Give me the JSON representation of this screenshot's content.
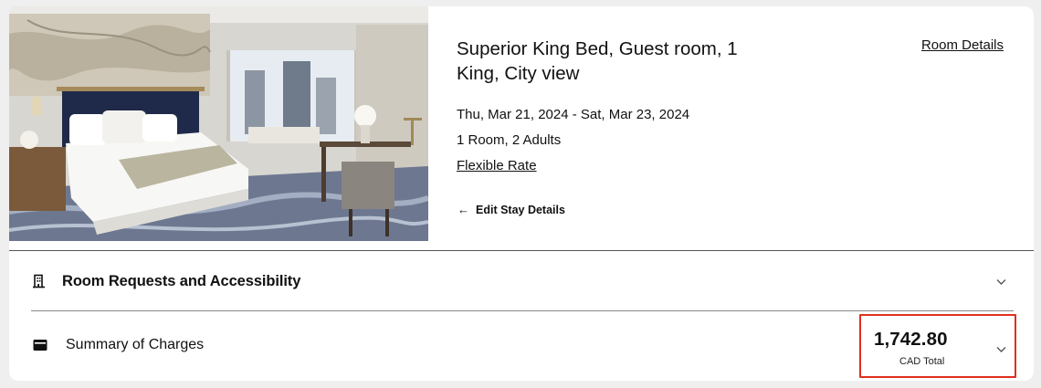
{
  "room": {
    "title": "Superior King Bed, Guest room, 1 King, City view",
    "details_link": "Room Details",
    "dates": "Thu, Mar 21, 2024 - Sat, Mar 23, 2024",
    "guests": "1 Room, 2 Adults",
    "rate": "Flexible Rate",
    "edit_label": "Edit Stay Details",
    "edit_icon": "arrow-left-icon",
    "photo_icon": "hotel-room-photo"
  },
  "sections": {
    "requests": {
      "label": "Room Requests and Accessibility",
      "icon": "building-icon"
    },
    "summary": {
      "label": "Summary of Charges",
      "icon": "wallet-icon",
      "total": "1,742.80",
      "total_label": "CAD Total"
    }
  },
  "colors": {
    "highlight": "#e0301e",
    "background": "#efefef",
    "card": "#ffffff"
  }
}
